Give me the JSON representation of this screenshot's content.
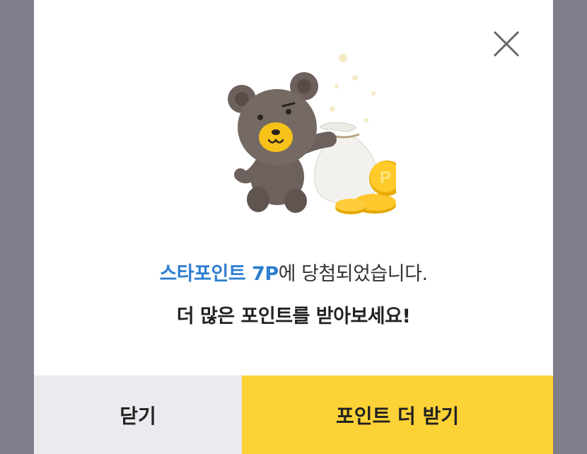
{
  "dialog": {
    "message_highlight": "스타포인트 7P",
    "message_rest": "에 당첨되었습니다.",
    "message_line2": "더 많은 포인트를 받아보세요!",
    "coin_label": "P"
  },
  "buttons": {
    "close_label": "닫기",
    "more_points_label": "포인트 더 받기"
  },
  "icons": {
    "close": "close-icon",
    "illustration": "bear-with-money-bag-illustration"
  },
  "colors": {
    "accent_blue": "#2e7ed0",
    "primary_yellow": "#fdd236",
    "secondary_gray": "#e9ebee",
    "overlay": "#7d7e89"
  }
}
